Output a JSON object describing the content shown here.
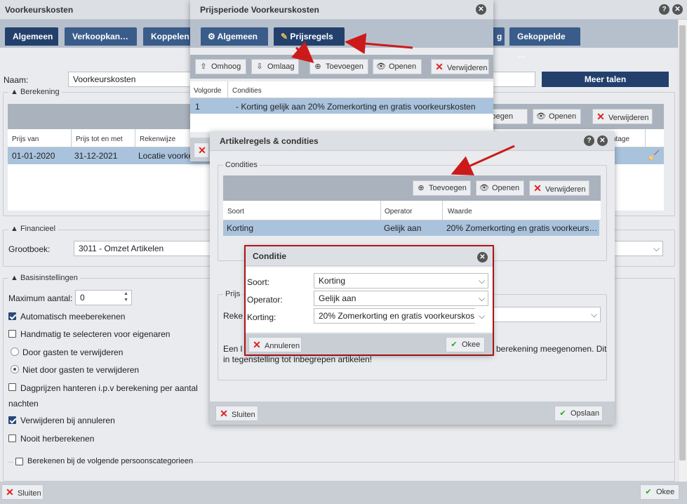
{
  "main": {
    "title": "Voorkeurskosten",
    "tabs": [
      "Algemeen",
      "Verkoopkan…",
      "Koppelen",
      "g",
      "Gekoppelde …"
    ],
    "naam_label": "Naam:",
    "naam_value": "Voorkeurskosten",
    "meer_talen": "Meer talen",
    "berekening_legend": "Berekening",
    "ber_columns": [
      "Prijs van",
      "Prijs tot en met",
      "Rekenwijze",
      "ntage"
    ],
    "ber_row": [
      "01-01-2020",
      "31-12-2021",
      "Locatie voorke"
    ],
    "ber_btn_toevoegen": "voegen",
    "ber_btn_openen": "Openen",
    "ber_btn_verwijderen": "Verwijderen",
    "financieel_legend": "Financieel",
    "grootboek_label": "Grootboek:",
    "grootboek_value": "3011 - Omzet Artikelen",
    "basis_legend": "Basisinstellingen",
    "max_label": "Maximum aantal:",
    "max_value": "0",
    "opt_auto": "Automatisch meeberekenen",
    "opt_handmatig": "Handmatig te selecteren voor eigenaren",
    "opt_door": "Door gasten te verwijderen",
    "opt_niet_door": "Niet door gasten te verwijderen",
    "opt_dagprijzen_1": "Dagprijzen hanteren i.p.v berekening per aantal",
    "opt_dagprijzen_2": "nachten",
    "opt_verwijderen": "Verwijderen bij annuleren",
    "opt_nooit": "Nooit herberekenen",
    "opt_berekenen_pc": "Berekenen bij de volgende persoonscategorieen",
    "sluiten": "Sluiten",
    "okee": "Okee"
  },
  "prijsperiode": {
    "title": "Prijsperiode Voorkeurskosten",
    "tabs": [
      "Algemeen",
      "Prijsregels"
    ],
    "btn_omhoog": "Omhoog",
    "btn_omlaag": "Omlaag",
    "btn_toevoegen": "Toevoegen",
    "btn_openen": "Openen",
    "btn_verwijderen": "Verwijderen",
    "columns": [
      "Volgorde",
      "Condities"
    ],
    "row": [
      "1",
      "- Korting gelijk aan 20% Zomerkorting en gratis voorkeurskosten"
    ]
  },
  "artikelregels": {
    "title": "Artikelregels & condities",
    "condities_legend": "Condities",
    "btn_toevoegen": "Toevoegen",
    "btn_openen": "Openen",
    "btn_verwijderen": "Verwijderen",
    "columns": [
      "Soort",
      "Operator",
      "Waarde"
    ],
    "row": [
      "Korting",
      "Gelijk aan",
      "20% Zomerkorting en gratis voorkeurs…"
    ],
    "prijs_legend": "Prijs",
    "reke_label": "Reke",
    "text_1_left": "Een l",
    "text_1_right": "berekening meegenomen. Dit",
    "text_2": "in tegenstelling tot inbegrepen artikelen!",
    "sluiten": "Sluiten",
    "opslaan": "Opslaan"
  },
  "conditie": {
    "title": "Conditie",
    "soort_label": "Soort:",
    "soort_value": "Korting",
    "operator_label": "Operator:",
    "operator_value": "Gelijk aan",
    "korting_label": "Korting:",
    "korting_value": "20% Zomerkorting en gratis voorkeurskos!",
    "annuleren": "Annuleren",
    "okee": "Okee"
  },
  "icons": {
    "help": "help-icon",
    "close": "close-icon",
    "red": "#cc1a1a"
  }
}
